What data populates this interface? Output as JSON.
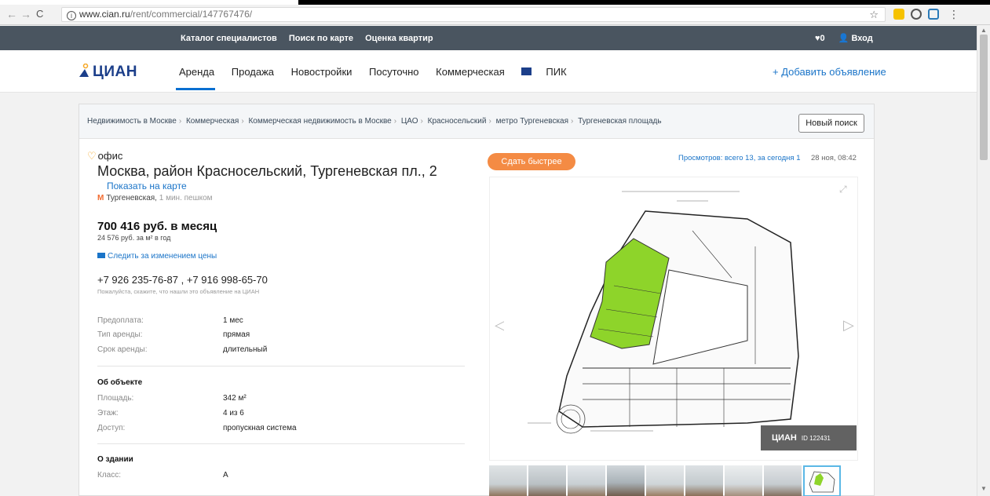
{
  "browser": {
    "url_domain": "www.cian.ru",
    "url_path": "/rent/commercial/147767476/"
  },
  "topnav": {
    "links": [
      "Каталог специалистов",
      "Поиск по карте",
      "Оценка квартир"
    ],
    "favorites_count": "0",
    "login": "Вход"
  },
  "header": {
    "logo": "ЦИАН",
    "nav": [
      "Аренда",
      "Продажа",
      "Новостройки",
      "Посуточно",
      "Коммерческая",
      "ПИК"
    ],
    "add_listing": "+ Добавить объявление"
  },
  "breadcrumbs": [
    "Недвижимость в Москве",
    "Коммерческая",
    "Коммерческая недвижимость в Москве",
    "ЦАО",
    "Красносельский",
    "метро Тургеневская",
    "Тургеневская площадь"
  ],
  "new_search": "Новый поиск",
  "listing": {
    "type": "офис",
    "address": "Москва, район Красносельский, Тургеневская пл., 2",
    "show_map": "Показать на карте",
    "metro": "Тургеневская,",
    "metro_walk": "1 мин. пешком",
    "price": "700 416 руб. в месяц",
    "price_per_m2": "24 576 руб. за м² в год",
    "follow_price": "Следить за изменением цены",
    "phones": "+7 926 235-76-87 , +7 916 998-65-70",
    "phone_note": "Пожалуйста, скажите, что нашли это объявление на ЦИАН",
    "terms": [
      {
        "label": "Предоплата:",
        "value": "1 мес"
      },
      {
        "label": "Тип аренды:",
        "value": "прямая"
      },
      {
        "label": "Срок аренды:",
        "value": "длительный"
      }
    ],
    "object_title": "Об объекте",
    "object": [
      {
        "label": "Площадь:",
        "value": "342 м²"
      },
      {
        "label": "Этаж:",
        "value": "4 из 6"
      },
      {
        "label": "Доступ:",
        "value": "пропускная система"
      }
    ],
    "building_title": "О здании",
    "building": [
      {
        "label": "Класс:",
        "value": "A"
      }
    ]
  },
  "right": {
    "sell_fast": "Сдать быстрее",
    "views": "Просмотров: всего 13, за сегодня 1",
    "date": "28 ноя, 08:42",
    "watermark_logo": "ЦИАН",
    "watermark_id": "ID 122431"
  },
  "colors": {
    "dark_nav": "#4a5560",
    "accent_blue": "#1a74c8",
    "logo_blue": "#1c3f8a",
    "orange": "#f48b44",
    "plan_green": "#8ed42a"
  }
}
